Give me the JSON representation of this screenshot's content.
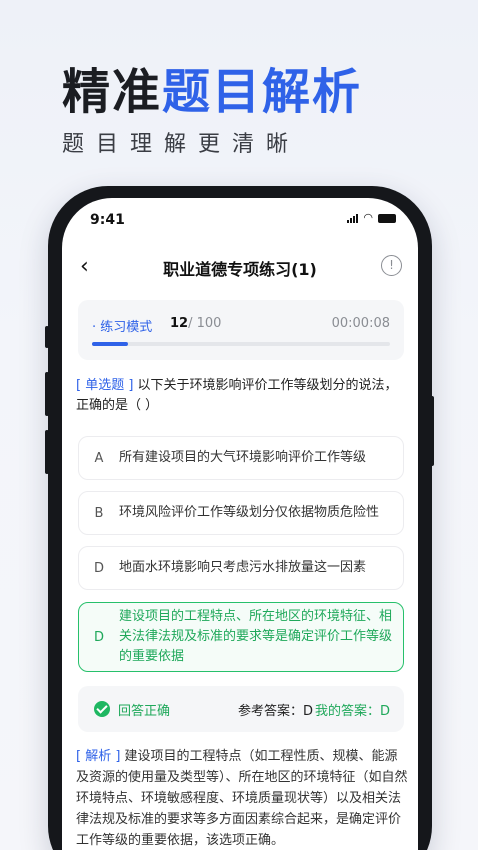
{
  "hero": {
    "title_dark": "精准",
    "title_blue": "题目解析",
    "subtitle": "题目理解更清晰"
  },
  "status_bar": {
    "time": "9:41"
  },
  "nav": {
    "back_icon": "‹",
    "title": "职业道德专项练习(1)",
    "info_icon": "!"
  },
  "mode": {
    "label": "· 练习模式",
    "current": "12",
    "total": "/ 100",
    "timer": "00:00:08",
    "progress_fraction": 0.12
  },
  "question": {
    "type": "[ 单选题 ]",
    "text": " 以下关于环境影响评价工作等级划分的说法，正确的是（ ）"
  },
  "options": [
    {
      "letter": "A",
      "text": "所有建设项目的大气环境影响评价工作等级",
      "correct": false
    },
    {
      "letter": "B",
      "text": "环境风险评价工作等级划分仅依据物质危险性",
      "correct": false
    },
    {
      "letter": "D",
      "text": "地面水环境影响只考虑污水排放量这一因素",
      "correct": false
    },
    {
      "letter": "D",
      "text": "建设项目的工程特点、所在地区的环境特征、相关法律法规及标准的要求等是确定评价工作等级的重要依据",
      "correct": true
    }
  ],
  "result": {
    "status": "回答正确",
    "reference_answer": "参考答案：D",
    "my_answer": "我的答案：D"
  },
  "analysis": {
    "label": "[ 解析 ]",
    "text": " 建设项目的工程特点（如工程性质、规模、能源及资源的使用量及类型等）、所在地区的环境特征（如自然环境特点、环境敏感程度、环境质量现状等）以及相关法律法规及标准的要求等多方面因素综合起来，是确定评价工作等级的重要依据，该选项正确。"
  },
  "colors": {
    "brand_blue": "#2f62e8",
    "correct_green": "#1fa85a"
  }
}
